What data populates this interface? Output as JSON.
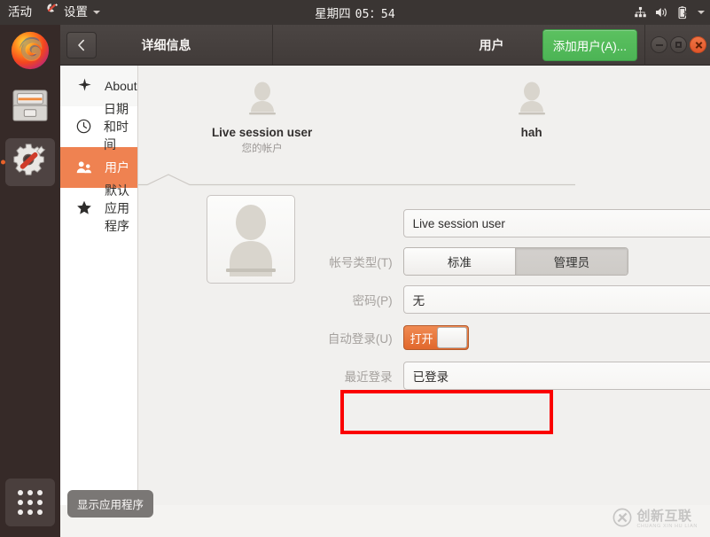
{
  "topbar": {
    "activities": "活动",
    "app_name": "设置",
    "app_icon": "settings-gear-wrench-icon",
    "clock_day": "星期四",
    "clock_time": "05：54",
    "status_icons": [
      "network-icon",
      "volume-icon",
      "battery-charging-icon",
      "dropdown-caret-icon"
    ]
  },
  "dock": {
    "items": [
      {
        "name": "firefox",
        "icon": "firefox-icon",
        "active": false
      },
      {
        "name": "files",
        "icon": "file-manager-icon",
        "active": false
      },
      {
        "name": "settings",
        "icon": "settings-gear-wrench-icon",
        "active": true
      }
    ],
    "show_apps_label": "显示应用程序",
    "show_apps_icon": "app-grid-icon"
  },
  "window": {
    "sidebar_title": "详细信息",
    "back_icon": "chevron-left-icon",
    "content_title": "用户",
    "add_user_label": "添加用户(A)...",
    "controls": {
      "minimize": "minimize-icon",
      "maximize": "maximize-icon",
      "close": "close-icon"
    }
  },
  "sidebar": {
    "items": [
      {
        "label": "About",
        "icon": "sparkle-icon",
        "selected": false
      },
      {
        "label": "日期和时间",
        "icon": "clock-icon",
        "selected": false
      },
      {
        "label": "用户",
        "icon": "users-icon",
        "selected": true
      },
      {
        "label": "默认应用程序",
        "icon": "star-icon",
        "selected": false
      }
    ]
  },
  "users": [
    {
      "name": "Live session user",
      "subtitle": "您的帐户",
      "avatar": "default-user-avatar",
      "selected": true
    },
    {
      "name": "hah",
      "subtitle": "",
      "avatar": "default-user-avatar",
      "selected": false
    }
  ],
  "detail": {
    "avatar_icon": "default-user-avatar-large",
    "name_value": "Live session user",
    "rows": [
      {
        "label": "帐号类型(T)",
        "type": "segmented",
        "options": [
          "标准",
          "管理员"
        ],
        "selected": "管理员"
      },
      {
        "label": "密码(P)",
        "type": "text",
        "value": "无"
      },
      {
        "label": "自动登录(U)",
        "type": "switch",
        "state_label": "打开",
        "on": true
      },
      {
        "label": "最近登录",
        "type": "text",
        "value": "已登录"
      }
    ]
  },
  "annotation": {
    "color": "#fb0000",
    "target": "自动登录(U)"
  },
  "watermark": {
    "cn": "创新互联",
    "en": "CHUANG XIN HU LIAN",
    "logo_icon": "cx-logo-icon"
  }
}
